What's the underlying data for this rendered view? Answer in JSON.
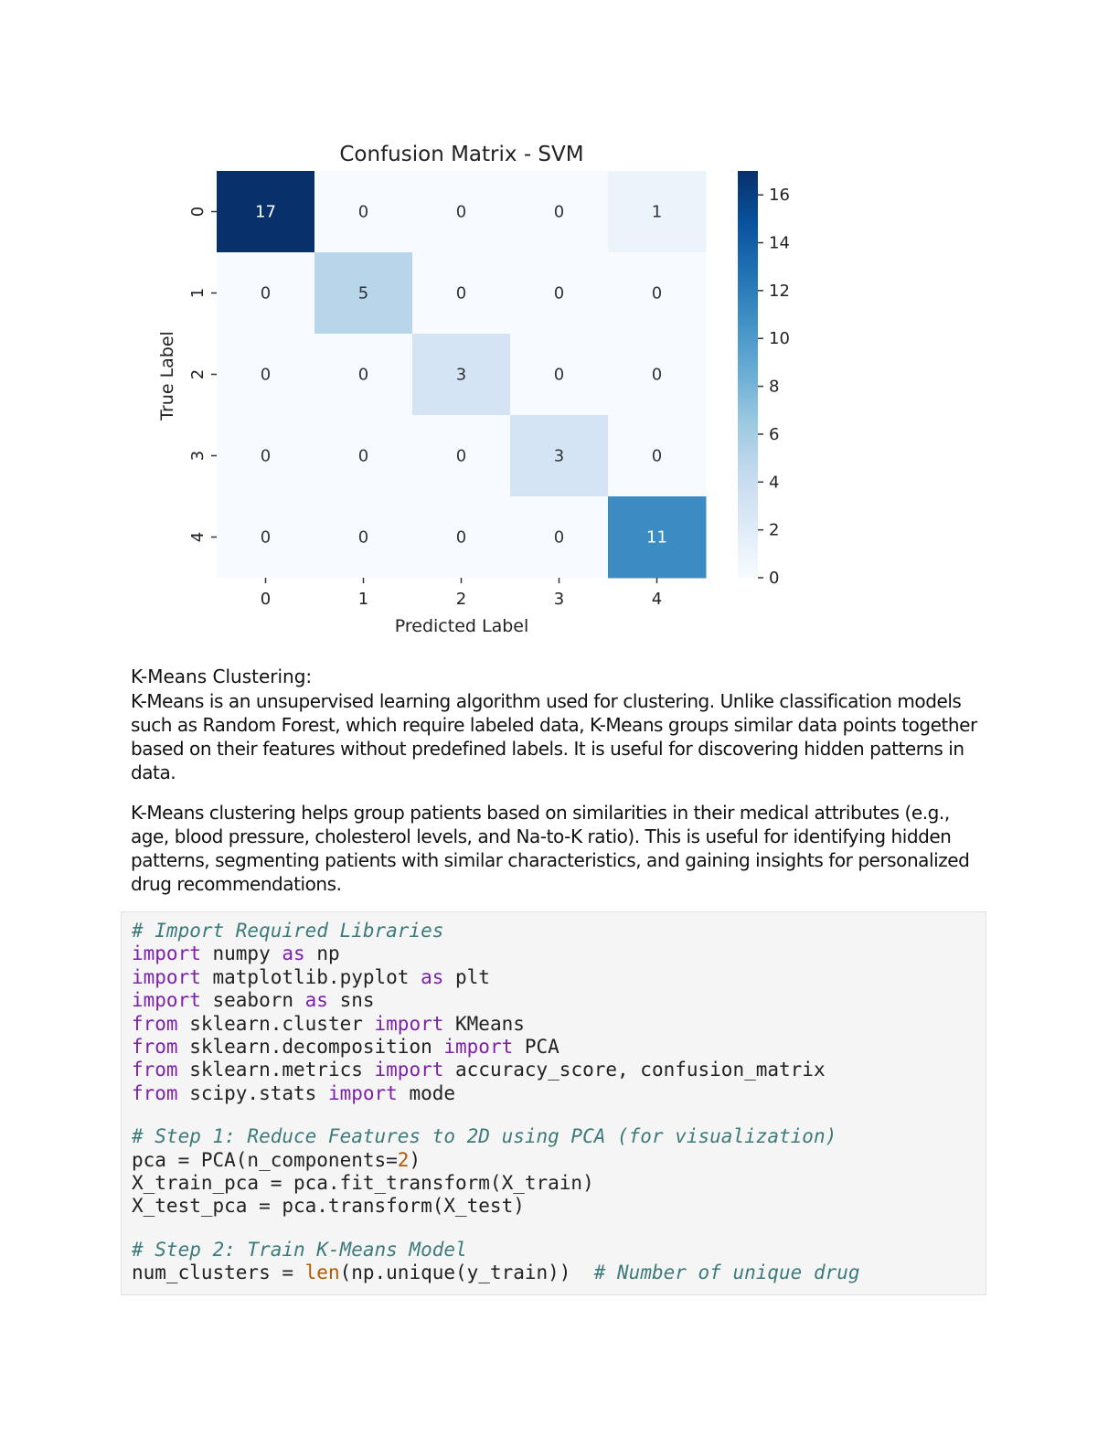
{
  "chart_data": {
    "type": "heatmap",
    "title": "Confusion Matrix - SVM",
    "xlabel": "Predicted Label",
    "ylabel": "True Label",
    "x_categories": [
      "0",
      "1",
      "2",
      "3",
      "4"
    ],
    "y_categories": [
      "0",
      "1",
      "2",
      "3",
      "4"
    ],
    "matrix": [
      [
        17,
        0,
        0,
        0,
        1
      ],
      [
        0,
        5,
        0,
        0,
        0
      ],
      [
        0,
        0,
        3,
        0,
        0
      ],
      [
        0,
        0,
        0,
        3,
        0
      ],
      [
        0,
        0,
        0,
        0,
        11
      ]
    ],
    "colormap": "Blues",
    "colorbar": {
      "min": 0,
      "max": 17,
      "ticks": [
        0,
        2,
        4,
        6,
        8,
        10,
        12,
        14,
        16
      ]
    },
    "colors": {
      "low": "#f7fbff",
      "high": "#08306b"
    }
  },
  "text": {
    "heading": "K-Means Clustering:",
    "para1": "K-Means is an unsupervised learning algorithm used for clustering. Unlike classification models such as Random Forest, which require labeled data, K-Means groups similar data points together based on their features without predefined labels. It is useful for discovering hidden patterns in data.",
    "para2": "K-Means clustering helps group patients based on similarities in their medical attributes (e.g., age, blood pressure, cholesterol levels, and Na-to-K ratio). This is useful for identifying hidden patterns, segmenting patients with similar characteristics, and gaining insights for personalized drug recommendations."
  },
  "code": {
    "lines": [
      [
        [
          "c",
          "# Import Required Libraries"
        ]
      ],
      [
        [
          "k",
          "import"
        ],
        [
          "t",
          " numpy "
        ],
        [
          "k",
          "as"
        ],
        [
          "t",
          " np"
        ]
      ],
      [
        [
          "k",
          "import"
        ],
        [
          "t",
          " matplotlib.pyplot "
        ],
        [
          "k",
          "as"
        ],
        [
          "t",
          " plt"
        ]
      ],
      [
        [
          "k",
          "import"
        ],
        [
          "t",
          " seaborn "
        ],
        [
          "k",
          "as"
        ],
        [
          "t",
          " sns"
        ]
      ],
      [
        [
          "k",
          "from"
        ],
        [
          "t",
          " sklearn.cluster "
        ],
        [
          "k",
          "import"
        ],
        [
          "t",
          " KMeans"
        ]
      ],
      [
        [
          "k",
          "from"
        ],
        [
          "t",
          " sklearn.decomposition "
        ],
        [
          "k",
          "import"
        ],
        [
          "t",
          " PCA"
        ]
      ],
      [
        [
          "k",
          "from"
        ],
        [
          "t",
          " sklearn.metrics "
        ],
        [
          "k",
          "import"
        ],
        [
          "t",
          " accuracy_score, confusion_matrix"
        ]
      ],
      [
        [
          "k",
          "from"
        ],
        [
          "t",
          " scipy.stats "
        ],
        [
          "k",
          "import"
        ],
        [
          "t",
          " mode"
        ]
      ],
      [],
      [
        [
          "c",
          "# Step 1: Reduce Features to 2D using PCA (for visualization)"
        ]
      ],
      [
        [
          "t",
          "pca = PCA(n_components="
        ],
        [
          "n",
          "2"
        ],
        [
          "t",
          ")"
        ]
      ],
      [
        [
          "t",
          "X_train_pca = pca.fit_transform(X_train)"
        ]
      ],
      [
        [
          "t",
          "X_test_pca = pca.transform(X_test)"
        ]
      ],
      [],
      [
        [
          "c",
          "# Step 2: Train K-Means Model"
        ]
      ],
      [
        [
          "t",
          "num_clusters = "
        ],
        [
          "b",
          "len"
        ],
        [
          "t",
          "(np.unique(y_train))  "
        ],
        [
          "c",
          "# Number of unique drug"
        ]
      ]
    ],
    "colors": {
      "comment": "#3d7a7a",
      "keyword": "#7b22a8",
      "number": "#b35900"
    }
  }
}
